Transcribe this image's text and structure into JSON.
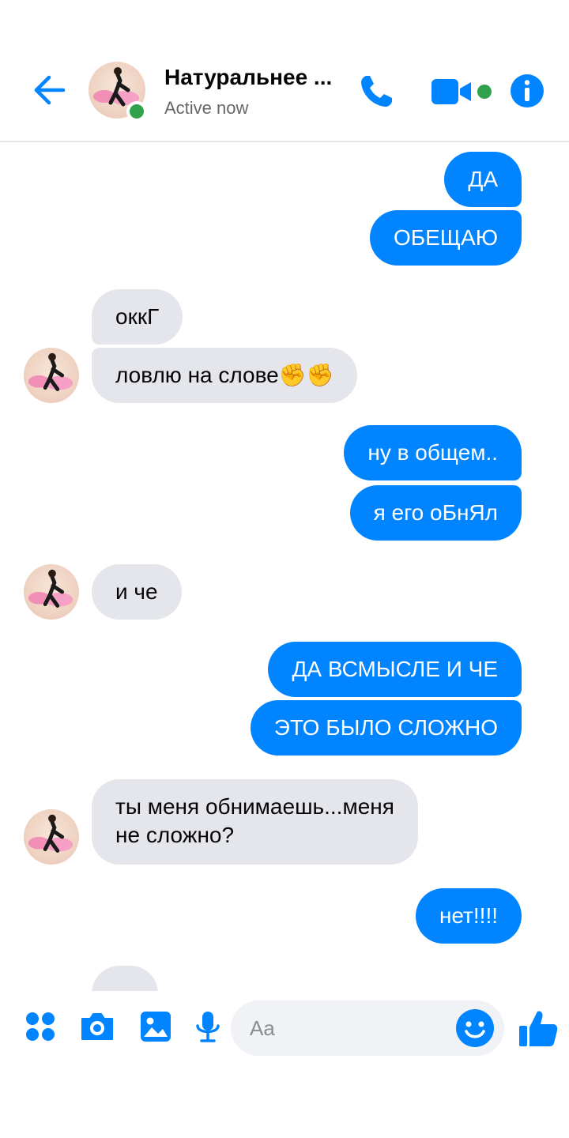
{
  "header": {
    "contact_name": "Натуральнее ...",
    "status": "Active now",
    "accent_color": "#0084ff",
    "online_color": "#31a24c",
    "icons": [
      "back-arrow-icon",
      "phone-icon",
      "video-camera-icon",
      "info-icon"
    ]
  },
  "messages": [
    {
      "dir": "out",
      "text": "ДА"
    },
    {
      "dir": "out",
      "text": "ОБЕЩАЮ"
    },
    {
      "dir": "in",
      "text": "оккГ"
    },
    {
      "dir": "in",
      "text": "ловлю на слове✊✊"
    },
    {
      "dir": "out",
      "text": "ну в общем.."
    },
    {
      "dir": "out",
      "text": "я его оБнЯл"
    },
    {
      "dir": "in",
      "text": "и че"
    },
    {
      "dir": "out",
      "text": "ДА ВСМЫСЛЕ И ЧЕ"
    },
    {
      "dir": "out",
      "text": "ЭТО БЫЛО СЛОЖНО"
    },
    {
      "dir": "in",
      "line1": "ты меня обнимаешь...меня",
      "line2": "не сложно?"
    },
    {
      "dir": "out",
      "text": "нет!!!!"
    }
  ],
  "composer": {
    "placeholder": "Aa",
    "icons": [
      "menu-dots-icon",
      "camera-icon",
      "gallery-icon",
      "microphone-icon",
      "emoji-smile-icon",
      "thumbs-up-icon"
    ]
  }
}
